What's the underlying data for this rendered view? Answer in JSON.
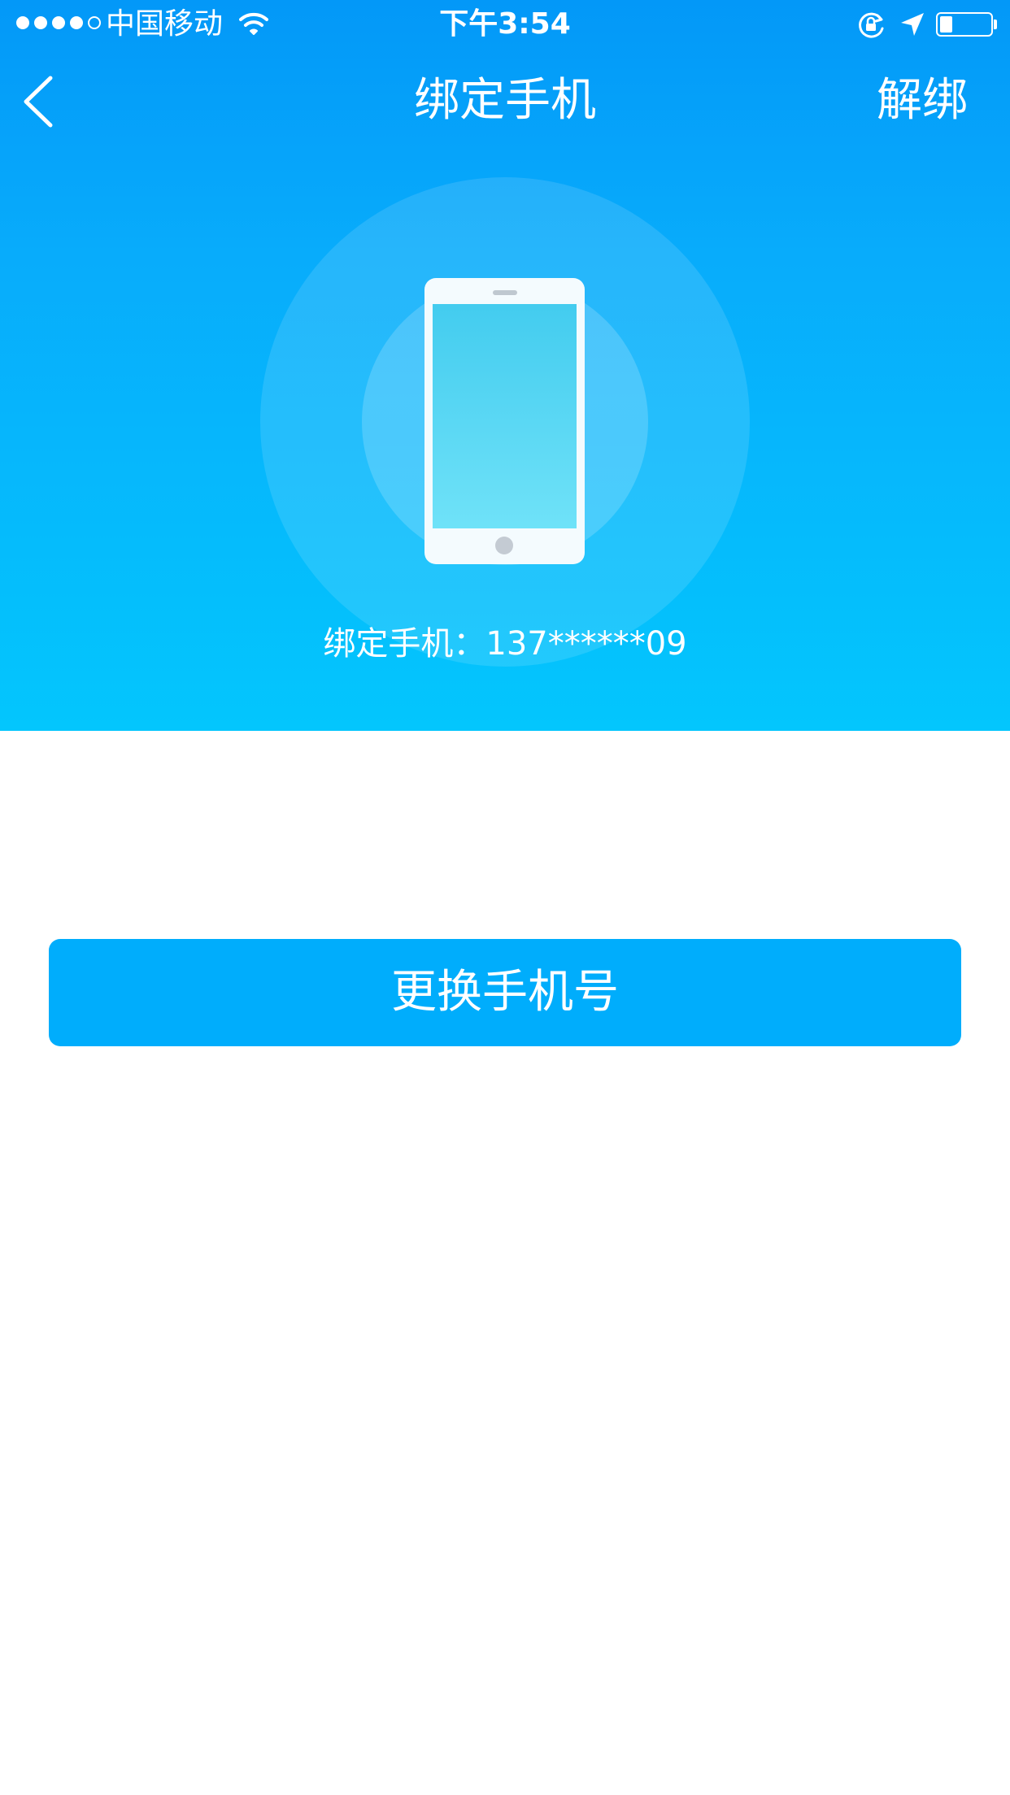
{
  "status_bar": {
    "carrier": "中国移动",
    "time": "下午3:54",
    "signal_strength": 4,
    "battery_level": 0.25,
    "icons": [
      "signal-icon",
      "wifi-icon",
      "orientation-lock-icon",
      "location-arrow-icon",
      "battery-icon"
    ]
  },
  "nav": {
    "back_icon": "chevron-left-icon",
    "title": "绑定手机",
    "unbind_label": "解绑"
  },
  "illustration": {
    "icon": "smartphone-icon"
  },
  "bound_phone": {
    "label": "绑定手机：137******09"
  },
  "actions": {
    "change_phone_label": "更换手机号"
  },
  "colors": {
    "header_top": "#0398f8",
    "header_bottom": "#03c6fd",
    "button": "#00adfc",
    "text_on_color": "#ffffff",
    "background": "#ffffff"
  }
}
